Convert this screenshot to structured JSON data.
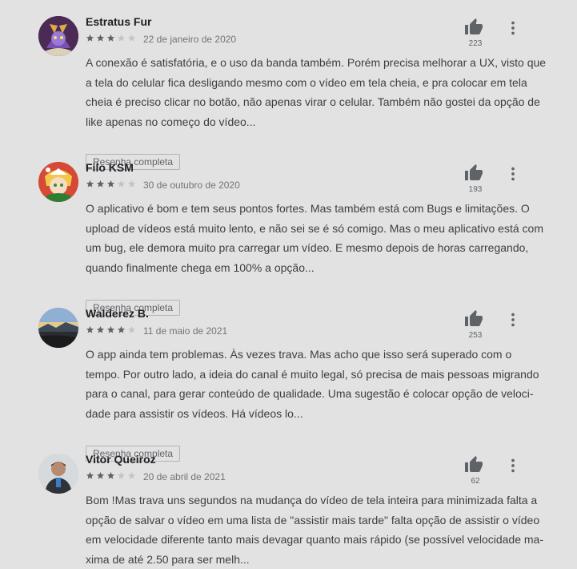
{
  "reviews": [
    {
      "author": "Estratus Fur",
      "rating": 3,
      "date": "22 de janeiro de 2020",
      "likes": "223",
      "lines": [
        "A conexão é satisfatória, e o uso da banda também. Porém precisa melhorar a UX, visto que",
        "a tela do celular fica desligando mesmo com o vídeo em tela cheia, e pra colocar em tela",
        "cheia é preciso clicar no botão, não apenas virar o celular. Também não gostei da opção de",
        "like apenas no começo do vídeo..."
      ],
      "button": "Resenha completa"
    },
    {
      "author": "Filo KSM",
      "rating": 3,
      "date": "30 de outubro de 2020",
      "likes": "193",
      "lines": [
        "O aplicativo é bom e tem seus pontos fortes. Mas também está com Bugs e limitações. O",
        "upload de vídeos está muito lento, e não sei se é só comigo. Mas o meu aplicativo está com",
        "um bug, ele demora muito pra carregar um vídeo. E mesmo depois de horas carregando,",
        "quando finalmente chega em 100% a opção..."
      ],
      "button": "Resenha completa"
    },
    {
      "author": "Walderez B.",
      "rating": 4,
      "date": "11 de maio de 2021",
      "likes": "253",
      "lines": [
        "O app ainda tem problemas. Às vezes trava. Mas acho que isso será superado com o",
        "tempo. Por outro lado, a ideia do canal é muito legal, só precisa de mais pessoas migrando",
        "para o canal, para gerar conteúdo de qualidade. Uma sugestão é colocar opção de veloci-",
        "dade para assistir os vídeos. Há vídeos lo..."
      ],
      "button": "Resenha completa"
    },
    {
      "author": "Vitor Queiroz",
      "rating": 3,
      "date": "20 de abril de 2021",
      "likes": "62",
      "lines": [
        "Bom !Mas trava uns segundos na mudança do vídeo de tela inteira para minimizada falta a",
        "opção de salvar o vídeo em uma lista de \"assistir mais tarde\" falta opção de assistir o vídeo",
        "em velocidade diferente tanto mais devagar quanto mais rápido (se possível velocidade ma-",
        "xima de até 2.50 para ser melh..."
      ],
      "button": ""
    }
  ],
  "icons": {
    "like": "thumbs-up-icon",
    "more": "more-vert-icon",
    "star": "star-icon"
  },
  "colors": {
    "star_filled": "#5f6368",
    "star_empty": "#c4c4c4",
    "background": "#e2e2e2"
  }
}
